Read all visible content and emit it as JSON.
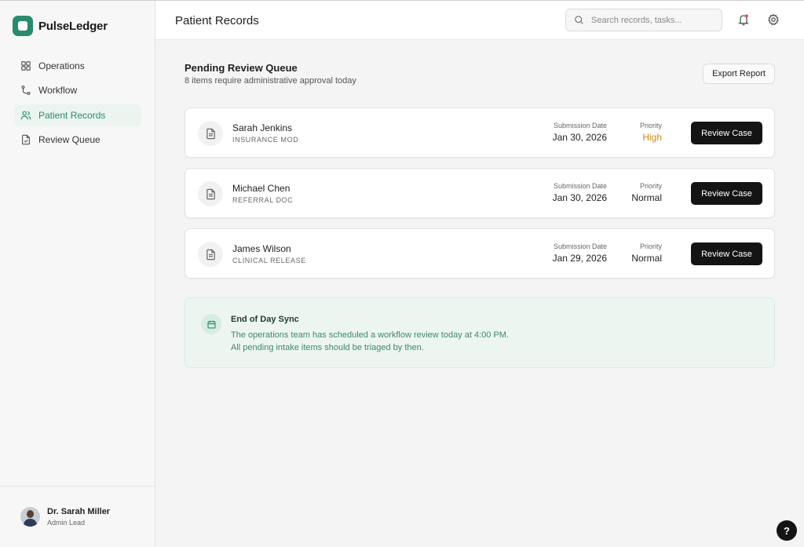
{
  "brand": {
    "name": "PulseLedger"
  },
  "sidebar": {
    "items": [
      {
        "label": "Operations",
        "icon": "grid-icon",
        "active": false
      },
      {
        "label": "Workflow",
        "icon": "git-branch-icon",
        "active": false
      },
      {
        "label": "Patient Records",
        "icon": "users-icon",
        "active": true
      },
      {
        "label": "Review Queue",
        "icon": "file-check-icon",
        "active": false
      }
    ],
    "user": {
      "name": "Dr. Sarah Miller",
      "role": "Admin Lead"
    }
  },
  "header": {
    "title": "Patient Records",
    "search_placeholder": "Search records, tasks..."
  },
  "queue": {
    "title": "Pending Review Queue",
    "subtitle": "8 items require administrative approval today",
    "export_label": "Export Report",
    "date_label": "Submission Date",
    "priority_label": "Priority",
    "review_label": "Review Case",
    "items": [
      {
        "name": "Sarah Jenkins",
        "type": "INSURANCE MOD",
        "date": "Jan 30, 2026",
        "priority": "High"
      },
      {
        "name": "Michael Chen",
        "type": "REFERRAL DOC",
        "date": "Jan 30, 2026",
        "priority": "Normal"
      },
      {
        "name": "James Wilson",
        "type": "CLINICAL RELEASE",
        "date": "Jan 29, 2026",
        "priority": "Normal"
      }
    ]
  },
  "notice": {
    "title": "End of Day Sync",
    "text": "The operations team has scheduled a workflow review today at 4:00 PM. All pending intake items should be triaged by then."
  },
  "help_label": "?",
  "colors": {
    "accent": "#2a8a6e",
    "high_priority": "#d4860b",
    "button_dark": "#141414"
  }
}
